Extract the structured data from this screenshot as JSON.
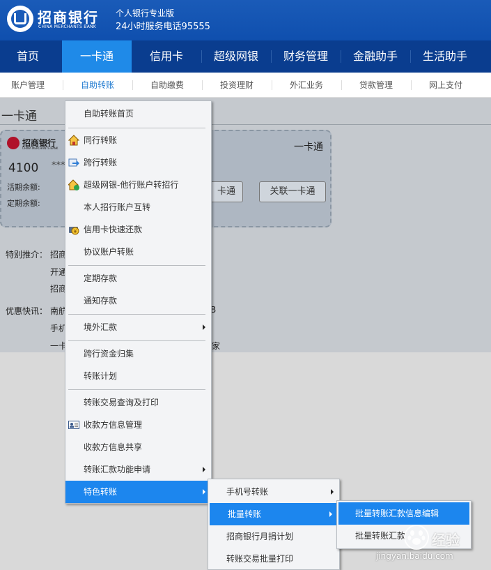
{
  "header": {
    "logo_cn": "招商银行",
    "logo_en": "CHINA MERCHANTS BANK",
    "slogan_line1": "个人银行专业版",
    "slogan_line2": "24小时服务电话95555",
    "brand_color": "#1a5bb8"
  },
  "main_nav": {
    "items": [
      {
        "label": "首页"
      },
      {
        "label": "一卡通",
        "active": true
      },
      {
        "label": "信用卡"
      },
      {
        "label": "超级网银"
      },
      {
        "label": "财务管理"
      },
      {
        "label": "金融助手"
      },
      {
        "label": "生活助手"
      }
    ]
  },
  "sub_nav": {
    "items": [
      {
        "label": "账户管理"
      },
      {
        "label": "自助转账",
        "active": true
      },
      {
        "label": "自助缴费"
      },
      {
        "label": "投资理财"
      },
      {
        "label": "外汇业务"
      },
      {
        "label": "贷款管理"
      },
      {
        "label": "网上支付"
      }
    ]
  },
  "section": {
    "title": "一卡通"
  },
  "card": {
    "logo_cn": "招商银行",
    "logo_en": "CHINA MERCHANTS BANK",
    "title": "一卡通",
    "number_prefix": "4100",
    "number_masked": "***",
    "current_label": "活期余额:",
    "fixed_label": "定期余额:",
    "btn_partial": "卡通",
    "btn_link": "关联一卡通"
  },
  "promo": {
    "special_label": "特别推介：",
    "special_line1": "招商",
    "special_line2": "开通",
    "special_line3": "招商",
    "news_label": "优惠快讯：",
    "news_line1": "南航",
    "news_line1_tail": "B",
    "news_line2": "手机",
    "news_line3": "一卡",
    "news_line3_tail": "家"
  },
  "menu": {
    "items": [
      {
        "label": "自助转账首页",
        "icon": null
      },
      {
        "label": "同行转账",
        "icon": "house-icon"
      },
      {
        "label": "跨行转账",
        "icon": "transfer-icon"
      },
      {
        "label": "超级网银-他行账户转招行",
        "icon": "house-arrow-icon"
      },
      {
        "label": "本人招行账户互转",
        "icon": null
      },
      {
        "label": "信用卡快速还款",
        "icon": "card-pay-icon"
      },
      {
        "label": "协议账户转账",
        "icon": null
      },
      {
        "label": "定期存款",
        "icon": null
      },
      {
        "label": "通知存款",
        "icon": null
      },
      {
        "label": "境外汇款",
        "icon": null,
        "submenu": true
      },
      {
        "label": "跨行资金归集",
        "icon": null
      },
      {
        "label": "转账计划",
        "icon": null
      },
      {
        "label": "转账交易查询及打印",
        "icon": null
      },
      {
        "label": "收款方信息管理",
        "icon": "contact-card-icon"
      },
      {
        "label": "收款方信息共享",
        "icon": null
      },
      {
        "label": "转账汇款功能申请",
        "icon": null,
        "submenu": true
      },
      {
        "label": "特色转账",
        "icon": null,
        "submenu": true,
        "selected": true
      }
    ]
  },
  "submenu": {
    "items": [
      {
        "label": "手机号转账",
        "submenu": true
      },
      {
        "label": "批量转账",
        "submenu": true,
        "selected": true
      },
      {
        "label": "招商银行月捐计划"
      },
      {
        "label": "转账交易批量打印"
      }
    ]
  },
  "submenu2": {
    "items": [
      {
        "label": "批量转账汇款信息编辑",
        "selected": true
      },
      {
        "label": "批量转账汇款"
      }
    ]
  },
  "watermark": {
    "text": "经验",
    "url": "jingyan.baidu.com"
  }
}
